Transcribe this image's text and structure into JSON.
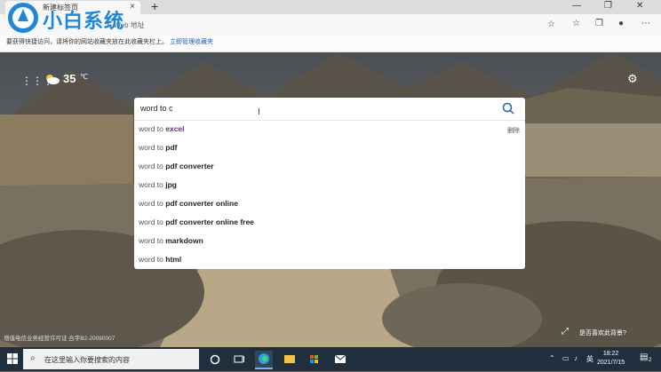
{
  "browser": {
    "tab_title": "新建标签页",
    "tab_close": "×",
    "new_tab": "+",
    "address_placeholder": "入 Web 地址",
    "win_min": "—",
    "win_max": "❐",
    "win_close": "✕"
  },
  "favbar": {
    "message": "要获得快捷访问，请将你的网站收藏夹放在此收藏夹栏上。",
    "link": "立即管理收藏夹"
  },
  "logo": {
    "text": "小白系统"
  },
  "weather": {
    "temp": "35",
    "unit": "℃"
  },
  "search": {
    "query": "word to c",
    "suggestions": [
      {
        "prefix": "word to ",
        "completion": "excel",
        "history": true
      },
      {
        "prefix": "word to ",
        "completion": "pdf"
      },
      {
        "prefix": "word to ",
        "completion": "pdf converter"
      },
      {
        "prefix": "word to ",
        "completion": "jpg"
      },
      {
        "prefix": "word to ",
        "completion": "pdf converter online"
      },
      {
        "prefix": "word to ",
        "completion": "pdf converter online free"
      },
      {
        "prefix": "word to ",
        "completion": "markdown"
      },
      {
        "prefix": "word to ",
        "completion": "html"
      }
    ],
    "delete_label": "删除"
  },
  "footer": {
    "license": "增值电信业务经营许可证 合字B2-20090007",
    "like_background": "是否喜欢此背景?"
  },
  "taskbar": {
    "search_placeholder": "在这里输入你要搜索的内容",
    "ime": "英",
    "time": "18:22",
    "date": "2021/7/15",
    "notif_count": "2"
  },
  "colors": {
    "accent": "#1a5fb4",
    "history": "#5a2a8a",
    "taskbar": "#1f2f3d"
  }
}
